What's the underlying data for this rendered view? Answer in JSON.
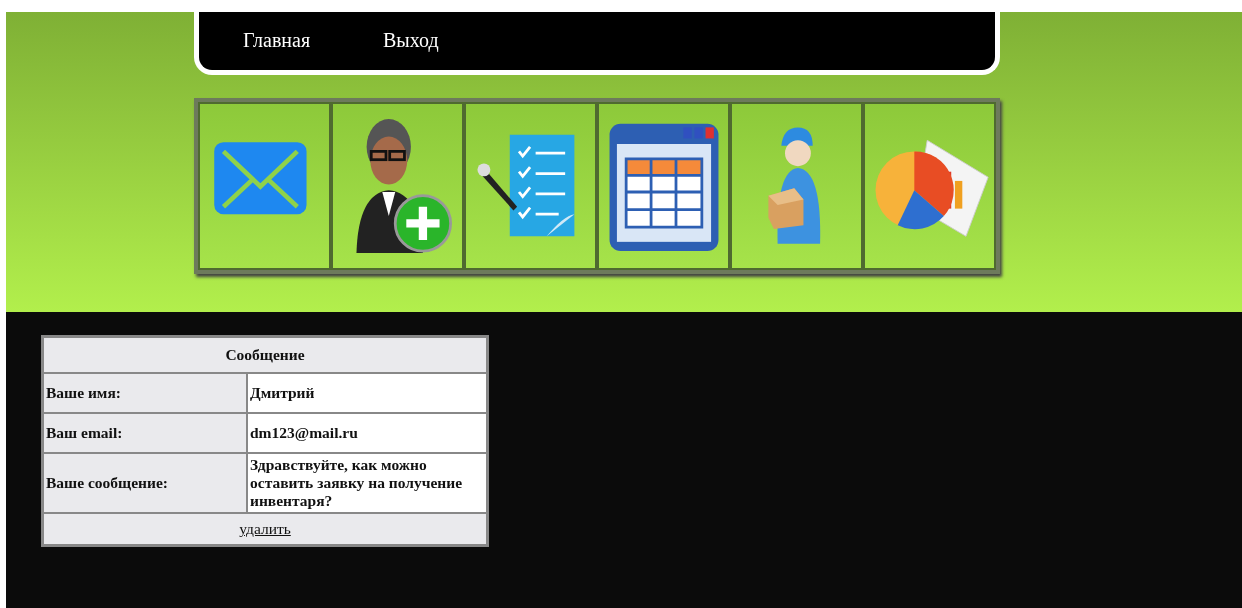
{
  "nav": {
    "items": [
      {
        "label": "Главная"
      },
      {
        "label": "Выход"
      }
    ]
  },
  "toolbar": {
    "icons": [
      {
        "kind": "envelope"
      },
      {
        "kind": "person-add"
      },
      {
        "kind": "checklist"
      },
      {
        "kind": "table-window"
      },
      {
        "kind": "courier"
      },
      {
        "kind": "pie-chart"
      }
    ]
  },
  "message": {
    "title": "Сообщение",
    "rows": [
      {
        "label": "Ваше имя:",
        "value": "Дмитрий"
      },
      {
        "label": "Ваш email:",
        "value": "dm123@mail.ru"
      },
      {
        "label": "Ваше сообщение:",
        "value": "Здравствуйте, как можно оставить заявку на получение инвентаря?"
      }
    ],
    "delete_link": "удалить"
  }
}
